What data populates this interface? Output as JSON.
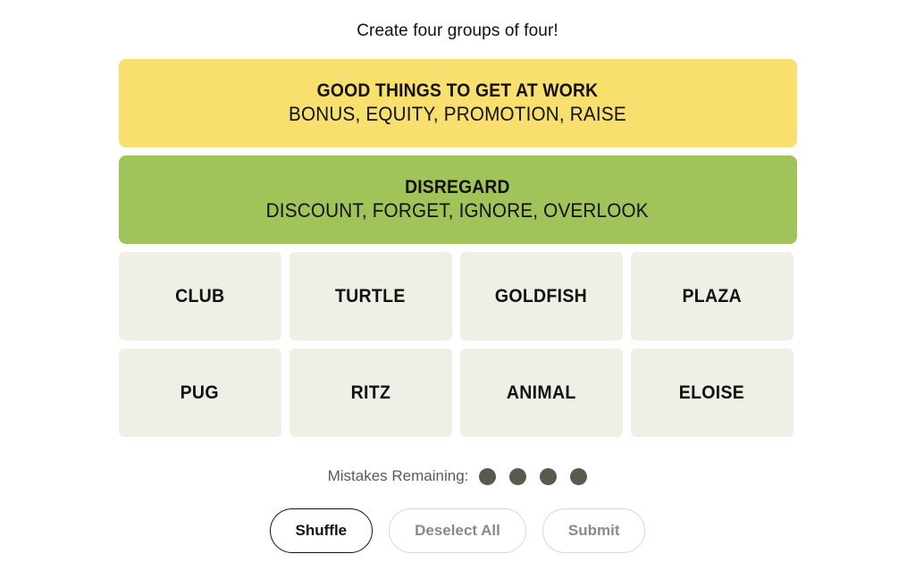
{
  "header": {
    "tagline": "Create four groups of four!"
  },
  "colors": {
    "yellow": "#F9DF6D",
    "green": "#A0C35A",
    "tile_bg": "#EFEFE6",
    "dot": "#5A594E",
    "page_bg": "#FFFFFF",
    "text": "#121212",
    "muted_text": "#5A5A5A",
    "disabled_border": "#D7D7D7",
    "disabled_text": "#8A8A8A"
  },
  "solved_groups": [
    {
      "title": "GOOD THINGS TO GET AT WORK",
      "members": "BONUS, EQUITY, PROMOTION, RAISE",
      "color": "#F9DF6D",
      "difficulty": "yellow"
    },
    {
      "title": "DISREGARD",
      "members": "DISCOUNT, FORGET, IGNORE, OVERLOOK",
      "color": "#A0C35A",
      "difficulty": "green"
    }
  ],
  "tile_rows": [
    [
      {
        "label": "CLUB"
      },
      {
        "label": "TURTLE"
      },
      {
        "label": "GOLDFISH"
      },
      {
        "label": "PLAZA"
      }
    ],
    [
      {
        "label": "PUG"
      },
      {
        "label": "RITZ"
      },
      {
        "label": "ANIMAL"
      },
      {
        "label": "ELOISE"
      }
    ]
  ],
  "mistakes": {
    "label": "Mistakes Remaining:",
    "remaining": 4,
    "dots": [
      1,
      2,
      3,
      4
    ]
  },
  "buttons": [
    {
      "label": "Shuffle",
      "state": "enabled"
    },
    {
      "label": "Deselect All",
      "state": "disabled"
    },
    {
      "label": "Submit",
      "state": "disabled"
    }
  ]
}
